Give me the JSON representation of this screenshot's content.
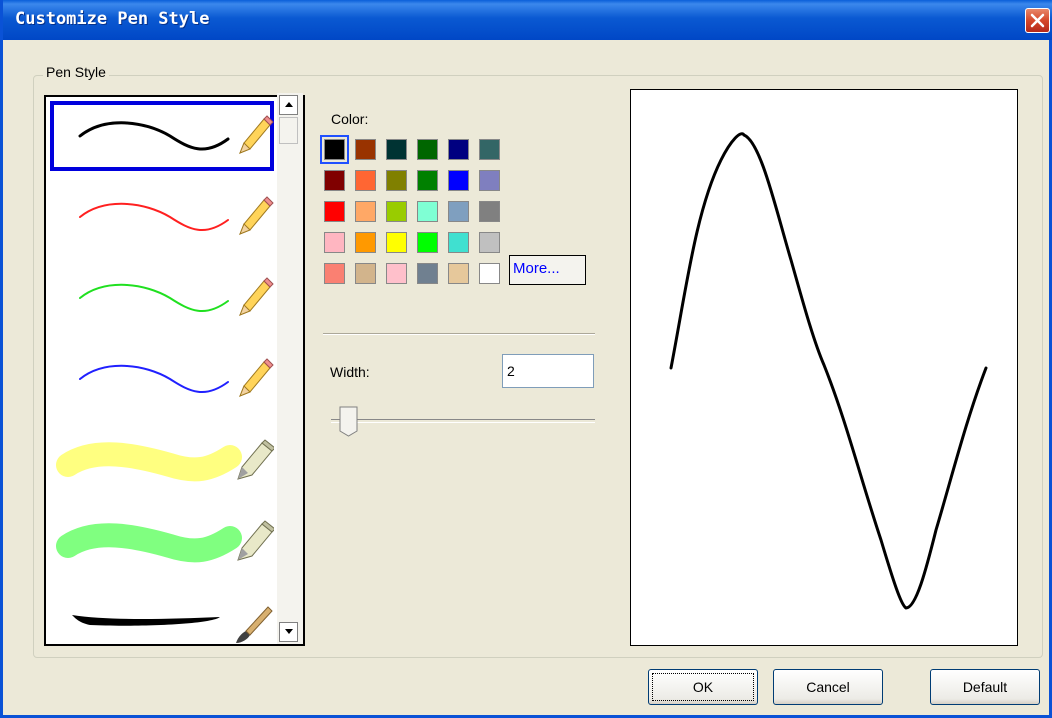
{
  "window": {
    "title": "Customize Pen Style"
  },
  "pen_style": {
    "group_label": "Pen Style",
    "selected_index": 0,
    "pens": [
      {
        "name": "black-pen",
        "color": "#000000",
        "kind": "pen"
      },
      {
        "name": "red-pen",
        "color": "#ff2020",
        "kind": "pen"
      },
      {
        "name": "green-pen",
        "color": "#20e020",
        "kind": "pen"
      },
      {
        "name": "blue-pen",
        "color": "#2020ff",
        "kind": "pen"
      },
      {
        "name": "yellow-highlighter",
        "color": "#ffff80",
        "kind": "highlighter"
      },
      {
        "name": "green-highlighter",
        "color": "#80ff80",
        "kind": "highlighter"
      },
      {
        "name": "black-brush",
        "color": "#000000",
        "kind": "brush"
      }
    ]
  },
  "color": {
    "label": "Color:",
    "selected": "#000000",
    "swatches": [
      [
        "#000000",
        "#993300",
        "#003333",
        "#006600",
        "#000080",
        "#336666"
      ],
      [
        "#800000",
        "#ff6633",
        "#808000",
        "#008000",
        "#0000ff",
        "#7f7fbf"
      ],
      [
        "#ff0000",
        "#ffa866",
        "#99cc00",
        "#7fffd4",
        "#7f9fbf",
        "#808080"
      ],
      [
        "#ffb6c1",
        "#ff9900",
        "#ffff00",
        "#00ff00",
        "#40e0d0",
        "#c0c0c0"
      ],
      [
        "#fa8072",
        "#d2b48c",
        "#ffc0cb",
        "#708090",
        "#e6c89b",
        "#ffffff"
      ]
    ],
    "more_label": "More..."
  },
  "width": {
    "label": "Width:",
    "value": "2",
    "slider_level": 0.02
  },
  "buttons": {
    "ok": "OK",
    "cancel": "Cancel",
    "default": "Default"
  }
}
